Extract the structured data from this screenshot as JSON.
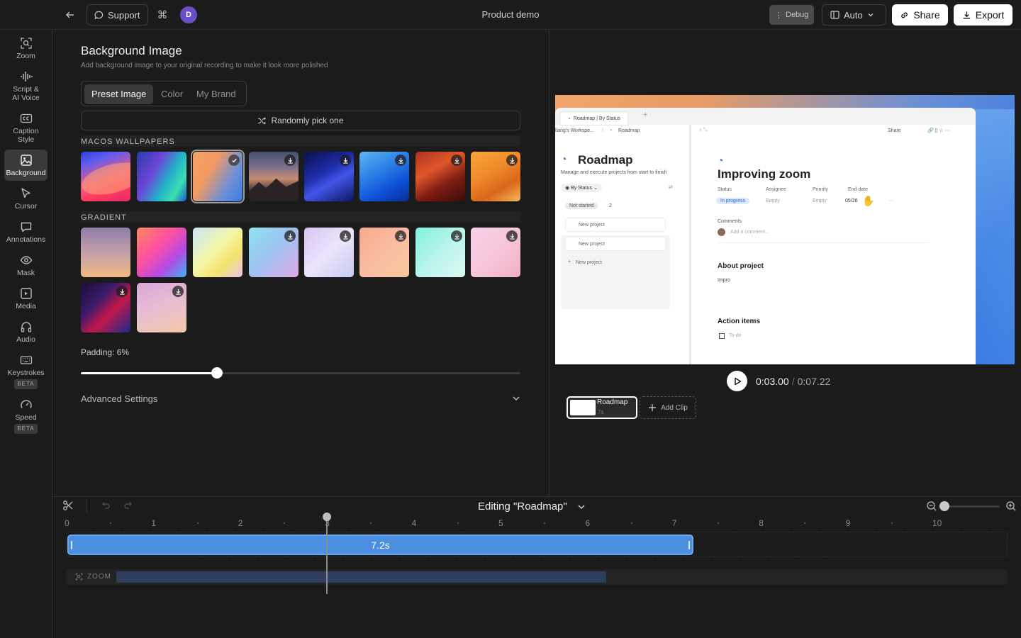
{
  "topbar": {
    "support_label": "Support",
    "avatar_initial": "D",
    "title": "Product demo",
    "debug_label": "Debug",
    "auto_label": "Auto",
    "share_label": "Share",
    "export_label": "Export"
  },
  "rail": {
    "items": [
      {
        "label": "Zoom",
        "icon": "zoom-icon"
      },
      {
        "label": "Script & AI Voice",
        "icon": "waveform-icon"
      },
      {
        "label": "Caption Style",
        "icon": "caption-icon"
      },
      {
        "label": "Background",
        "icon": "image-icon"
      },
      {
        "label": "Cursor",
        "icon": "cursor-icon"
      },
      {
        "label": "Annotations",
        "icon": "comment-icon"
      },
      {
        "label": "Mask",
        "icon": "eye-icon"
      },
      {
        "label": "Media",
        "icon": "media-icon"
      },
      {
        "label": "Audio",
        "icon": "headphones-icon"
      },
      {
        "label": "Keystrokes",
        "icon": "keyboard-icon"
      },
      {
        "label": "Speed",
        "icon": "gauge-icon"
      }
    ],
    "beta": "BETA"
  },
  "panel": {
    "title": "Background Image",
    "subtitle": "Add background image to your original recording to make it look more polished",
    "tabs": [
      "Preset Image",
      "Color",
      "My Brand"
    ],
    "random_label": "Randomly pick one",
    "section_macos": "MACOS WALLPAPERS",
    "section_gradient": "GRADIENT",
    "padding_label": "Padding: 6%",
    "padding_value": 0.31,
    "advanced_label": "Advanced Settings"
  },
  "preview": {
    "tab_title": "Roadmap | By Status",
    "crumb_workspace": "llang's Workspe...",
    "crumb_page": "Roadmap",
    "share_label": "Share",
    "left_title": "Roadmap",
    "left_desc": "Manage and execute projects from start to finish",
    "view_label": "By Status",
    "group_label": "Not started",
    "group_count": "2",
    "card1": "New project",
    "card2": "New project",
    "card3": "New project",
    "page_title": "Improving zoom",
    "prop_status": "Status",
    "prop_assignee": "Assignee",
    "prop_priority": "Priority",
    "prop_end": "End date",
    "val_status": "In progress",
    "val_assignee": "Empty",
    "val_priority": "Empty",
    "val_end": "05/26",
    "comments_label": "Comments",
    "add_comment": "Add a comment...",
    "about_label": "About project",
    "about_text": "Impro",
    "actions_label": "Action items",
    "todo_label": "To-do"
  },
  "player": {
    "current": "0:03.00",
    "separator": "/",
    "total": "0:07.22"
  },
  "clips": {
    "name": "Roadmap",
    "duration": "7s",
    "add_label": "Add Clip"
  },
  "timeline": {
    "editing_label": "Editing \"Roadmap\"",
    "ruler": [
      "0",
      "1",
      "2",
      "3",
      "4",
      "5",
      "6",
      "7",
      "8",
      "9",
      "10"
    ],
    "clip_duration": "7.2s",
    "zoom_label": "ZOOM",
    "playhead_seconds": 3.0
  },
  "colors": {
    "accent_blue": "#4c8fe0",
    "avatar_purple": "#6b4fc7",
    "zoom_segment": "#2e3d5e"
  }
}
